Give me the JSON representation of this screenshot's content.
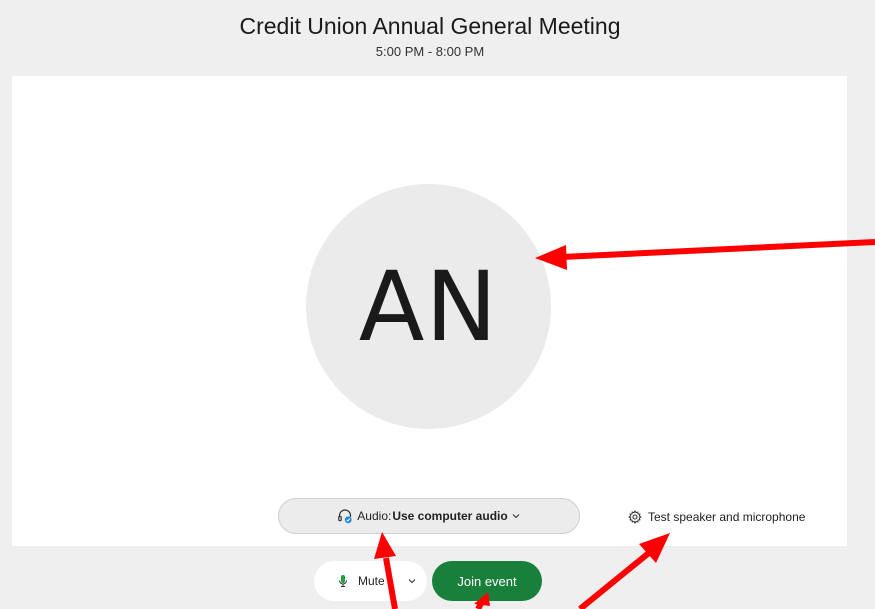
{
  "meeting": {
    "title": "Credit Union Annual General Meeting",
    "time": "5:00 PM - 8:00 PM"
  },
  "avatar": {
    "initials": "AN"
  },
  "audio": {
    "label": "Audio:",
    "value": "Use computer audio",
    "icon": "headset-icon"
  },
  "test": {
    "label": "Test speaker and microphone",
    "icon": "gear-icon"
  },
  "mute": {
    "label": "Mute",
    "icon": "microphone-icon"
  },
  "join": {
    "label": "Join event"
  },
  "colors": {
    "join_green": "#18803a",
    "mic_green": "#1aa33f",
    "annotation_red": "#ff0000",
    "page_bg": "#efefef",
    "avatar_bg": "#ebebeb"
  }
}
